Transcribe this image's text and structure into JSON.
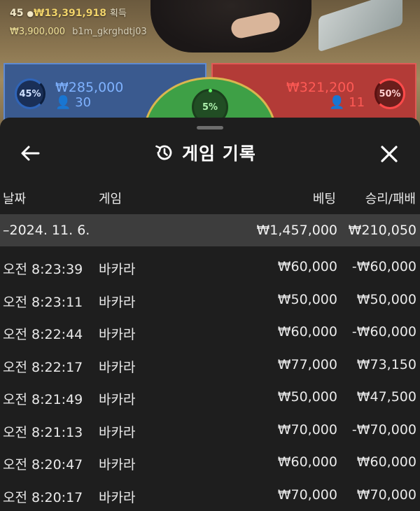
{
  "live": {
    "round_no": "45",
    "winnings": "₩13,391,918",
    "winnings_suffix": "획득",
    "balance": "₩3,900,000",
    "user_id": "b1m_gkrghdtj03"
  },
  "bet_board": {
    "player": {
      "percent": "45%",
      "amount": "₩285,000",
      "count": "30"
    },
    "banker": {
      "percent": "50%",
      "amount": "₩321,200",
      "count": "11"
    },
    "tie": {
      "percent": "5%"
    }
  },
  "sheet": {
    "title": "게임 기록",
    "back_icon": "←",
    "close_icon": "✕",
    "columns": {
      "date": "날짜",
      "game": "게임",
      "bet": "베팅",
      "win_loss": "승리/패배"
    },
    "summary": {
      "date": "–2024. 11. 6.",
      "bet": "₩1,457,000",
      "win_loss": "₩210,050"
    },
    "rows": [
      {
        "time": "오전 8:23:39",
        "game": "바카라",
        "bet": "₩60,000",
        "win_loss": "-₩60,000"
      },
      {
        "time": "오전 8:23:11",
        "game": "바카라",
        "bet": "₩50,000",
        "win_loss": "₩50,000"
      },
      {
        "time": "오전 8:22:44",
        "game": "바카라",
        "bet": "₩60,000",
        "win_loss": "-₩60,000"
      },
      {
        "time": "오전 8:22:17",
        "game": "바카라",
        "bet": "₩77,000",
        "win_loss": "₩73,150"
      },
      {
        "time": "오전 8:21:49",
        "game": "바카라",
        "bet": "₩50,000",
        "win_loss": "₩47,500"
      },
      {
        "time": "오전 8:21:13",
        "game": "바카라",
        "bet": "₩70,000",
        "win_loss": "-₩70,000"
      },
      {
        "time": "오전 8:20:47",
        "game": "바카라",
        "bet": "₩60,000",
        "win_loss": "₩60,000"
      },
      {
        "time": "오전 8:20:17",
        "game": "바카라",
        "bet": "₩70,000",
        "win_loss": "₩70,000"
      }
    ]
  }
}
